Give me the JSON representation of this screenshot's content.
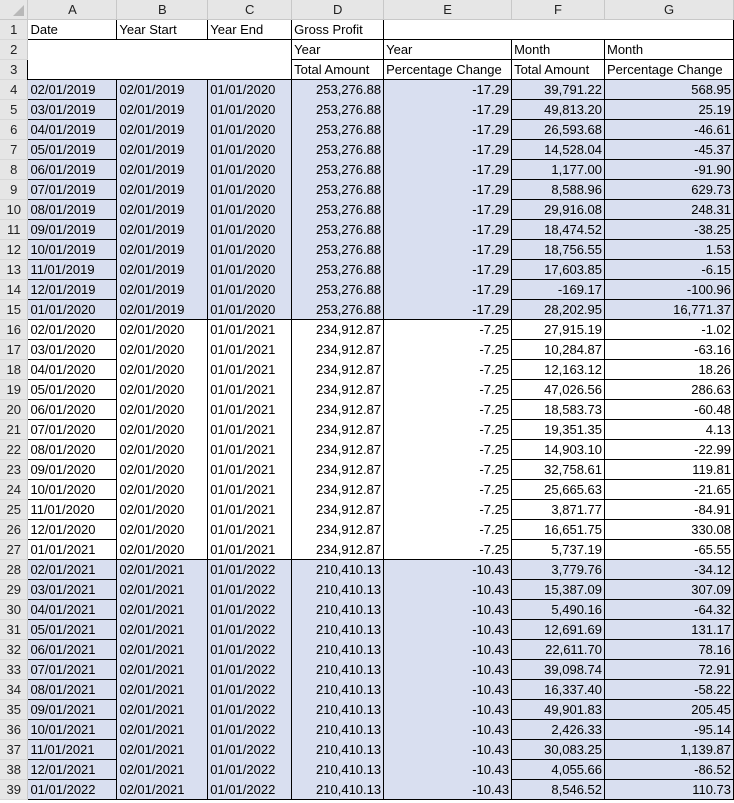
{
  "app": "Spreadsheet",
  "columns": [
    "A",
    "B",
    "C",
    "D",
    "E",
    "F",
    "G"
  ],
  "header": {
    "row1": {
      "A": "Date",
      "B": "Year Start",
      "C": "Year End",
      "D": "Gross Profit",
      "E": "",
      "F": "",
      "G": ""
    },
    "row2": {
      "D": "Year",
      "E": "Year",
      "F": "Month",
      "G": "Month"
    },
    "row3": {
      "D": "Total Amount",
      "E": "Percentage Change",
      "F": "Total Amount",
      "G": "Percentage Change"
    }
  },
  "band_color": "#d9dff0",
  "rows": [
    {
      "n": "4",
      "date": "02/01/2019",
      "ys": "02/01/2019",
      "ye": "01/01/2020",
      "ytot": "253,276.88",
      "ypct": "-17.29",
      "mtot": "39,791.22",
      "mpct": "568.95"
    },
    {
      "n": "5",
      "date": "03/01/2019",
      "ys": "02/01/2019",
      "ye": "01/01/2020",
      "ytot": "253,276.88",
      "ypct": "-17.29",
      "mtot": "49,813.20",
      "mpct": "25.19"
    },
    {
      "n": "6",
      "date": "04/01/2019",
      "ys": "02/01/2019",
      "ye": "01/01/2020",
      "ytot": "253,276.88",
      "ypct": "-17.29",
      "mtot": "26,593.68",
      "mpct": "-46.61"
    },
    {
      "n": "7",
      "date": "05/01/2019",
      "ys": "02/01/2019",
      "ye": "01/01/2020",
      "ytot": "253,276.88",
      "ypct": "-17.29",
      "mtot": "14,528.04",
      "mpct": "-45.37"
    },
    {
      "n": "8",
      "date": "06/01/2019",
      "ys": "02/01/2019",
      "ye": "01/01/2020",
      "ytot": "253,276.88",
      "ypct": "-17.29",
      "mtot": "1,177.00",
      "mpct": "-91.90"
    },
    {
      "n": "9",
      "date": "07/01/2019",
      "ys": "02/01/2019",
      "ye": "01/01/2020",
      "ytot": "253,276.88",
      "ypct": "-17.29",
      "mtot": "8,588.96",
      "mpct": "629.73"
    },
    {
      "n": "10",
      "date": "08/01/2019",
      "ys": "02/01/2019",
      "ye": "01/01/2020",
      "ytot": "253,276.88",
      "ypct": "-17.29",
      "mtot": "29,916.08",
      "mpct": "248.31"
    },
    {
      "n": "11",
      "date": "09/01/2019",
      "ys": "02/01/2019",
      "ye": "01/01/2020",
      "ytot": "253,276.88",
      "ypct": "-17.29",
      "mtot": "18,474.52",
      "mpct": "-38.25"
    },
    {
      "n": "12",
      "date": "10/01/2019",
      "ys": "02/01/2019",
      "ye": "01/01/2020",
      "ytot": "253,276.88",
      "ypct": "-17.29",
      "mtot": "18,756.55",
      "mpct": "1.53"
    },
    {
      "n": "13",
      "date": "11/01/2019",
      "ys": "02/01/2019",
      "ye": "01/01/2020",
      "ytot": "253,276.88",
      "ypct": "-17.29",
      "mtot": "17,603.85",
      "mpct": "-6.15"
    },
    {
      "n": "14",
      "date": "12/01/2019",
      "ys": "02/01/2019",
      "ye": "01/01/2020",
      "ytot": "253,276.88",
      "ypct": "-17.29",
      "mtot": "-169.17",
      "mpct": "-100.96"
    },
    {
      "n": "15",
      "date": "01/01/2020",
      "ys": "02/01/2019",
      "ye": "01/01/2020",
      "ytot": "253,276.88",
      "ypct": "-17.29",
      "mtot": "28,202.95",
      "mpct": "16,771.37"
    },
    {
      "n": "16",
      "date": "02/01/2020",
      "ys": "02/01/2020",
      "ye": "01/01/2021",
      "ytot": "234,912.87",
      "ypct": "-7.25",
      "mtot": "27,915.19",
      "mpct": "-1.02"
    },
    {
      "n": "17",
      "date": "03/01/2020",
      "ys": "02/01/2020",
      "ye": "01/01/2021",
      "ytot": "234,912.87",
      "ypct": "-7.25",
      "mtot": "10,284.87",
      "mpct": "-63.16"
    },
    {
      "n": "18",
      "date": "04/01/2020",
      "ys": "02/01/2020",
      "ye": "01/01/2021",
      "ytot": "234,912.87",
      "ypct": "-7.25",
      "mtot": "12,163.12",
      "mpct": "18.26"
    },
    {
      "n": "19",
      "date": "05/01/2020",
      "ys": "02/01/2020",
      "ye": "01/01/2021",
      "ytot": "234,912.87",
      "ypct": "-7.25",
      "mtot": "47,026.56",
      "mpct": "286.63"
    },
    {
      "n": "20",
      "date": "06/01/2020",
      "ys": "02/01/2020",
      "ye": "01/01/2021",
      "ytot": "234,912.87",
      "ypct": "-7.25",
      "mtot": "18,583.73",
      "mpct": "-60.48"
    },
    {
      "n": "21",
      "date": "07/01/2020",
      "ys": "02/01/2020",
      "ye": "01/01/2021",
      "ytot": "234,912.87",
      "ypct": "-7.25",
      "mtot": "19,351.35",
      "mpct": "4.13"
    },
    {
      "n": "22",
      "date": "08/01/2020",
      "ys": "02/01/2020",
      "ye": "01/01/2021",
      "ytot": "234,912.87",
      "ypct": "-7.25",
      "mtot": "14,903.10",
      "mpct": "-22.99"
    },
    {
      "n": "23",
      "date": "09/01/2020",
      "ys": "02/01/2020",
      "ye": "01/01/2021",
      "ytot": "234,912.87",
      "ypct": "-7.25",
      "mtot": "32,758.61",
      "mpct": "119.81"
    },
    {
      "n": "24",
      "date": "10/01/2020",
      "ys": "02/01/2020",
      "ye": "01/01/2021",
      "ytot": "234,912.87",
      "ypct": "-7.25",
      "mtot": "25,665.63",
      "mpct": "-21.65"
    },
    {
      "n": "25",
      "date": "11/01/2020",
      "ys": "02/01/2020",
      "ye": "01/01/2021",
      "ytot": "234,912.87",
      "ypct": "-7.25",
      "mtot": "3,871.77",
      "mpct": "-84.91"
    },
    {
      "n": "26",
      "date": "12/01/2020",
      "ys": "02/01/2020",
      "ye": "01/01/2021",
      "ytot": "234,912.87",
      "ypct": "-7.25",
      "mtot": "16,651.75",
      "mpct": "330.08"
    },
    {
      "n": "27",
      "date": "01/01/2021",
      "ys": "02/01/2020",
      "ye": "01/01/2021",
      "ytot": "234,912.87",
      "ypct": "-7.25",
      "mtot": "5,737.19",
      "mpct": "-65.55"
    },
    {
      "n": "28",
      "date": "02/01/2021",
      "ys": "02/01/2021",
      "ye": "01/01/2022",
      "ytot": "210,410.13",
      "ypct": "-10.43",
      "mtot": "3,779.76",
      "mpct": "-34.12"
    },
    {
      "n": "29",
      "date": "03/01/2021",
      "ys": "02/01/2021",
      "ye": "01/01/2022",
      "ytot": "210,410.13",
      "ypct": "-10.43",
      "mtot": "15,387.09",
      "mpct": "307.09"
    },
    {
      "n": "30",
      "date": "04/01/2021",
      "ys": "02/01/2021",
      "ye": "01/01/2022",
      "ytot": "210,410.13",
      "ypct": "-10.43",
      "mtot": "5,490.16",
      "mpct": "-64.32"
    },
    {
      "n": "31",
      "date": "05/01/2021",
      "ys": "02/01/2021",
      "ye": "01/01/2022",
      "ytot": "210,410.13",
      "ypct": "-10.43",
      "mtot": "12,691.69",
      "mpct": "131.17"
    },
    {
      "n": "32",
      "date": "06/01/2021",
      "ys": "02/01/2021",
      "ye": "01/01/2022",
      "ytot": "210,410.13",
      "ypct": "-10.43",
      "mtot": "22,611.70",
      "mpct": "78.16"
    },
    {
      "n": "33",
      "date": "07/01/2021",
      "ys": "02/01/2021",
      "ye": "01/01/2022",
      "ytot": "210,410.13",
      "ypct": "-10.43",
      "mtot": "39,098.74",
      "mpct": "72.91"
    },
    {
      "n": "34",
      "date": "08/01/2021",
      "ys": "02/01/2021",
      "ye": "01/01/2022",
      "ytot": "210,410.13",
      "ypct": "-10.43",
      "mtot": "16,337.40",
      "mpct": "-58.22"
    },
    {
      "n": "35",
      "date": "09/01/2021",
      "ys": "02/01/2021",
      "ye": "01/01/2022",
      "ytot": "210,410.13",
      "ypct": "-10.43",
      "mtot": "49,901.83",
      "mpct": "205.45"
    },
    {
      "n": "36",
      "date": "10/01/2021",
      "ys": "02/01/2021",
      "ye": "01/01/2022",
      "ytot": "210,410.13",
      "ypct": "-10.43",
      "mtot": "2,426.33",
      "mpct": "-95.14"
    },
    {
      "n": "37",
      "date": "11/01/2021",
      "ys": "02/01/2021",
      "ye": "01/01/2022",
      "ytot": "210,410.13",
      "ypct": "-10.43",
      "mtot": "30,083.25",
      "mpct": "1,139.87"
    },
    {
      "n": "38",
      "date": "12/01/2021",
      "ys": "02/01/2021",
      "ye": "01/01/2022",
      "ytot": "210,410.13",
      "ypct": "-10.43",
      "mtot": "4,055.66",
      "mpct": "-86.52"
    },
    {
      "n": "39",
      "date": "01/01/2022",
      "ys": "02/01/2021",
      "ye": "01/01/2022",
      "ytot": "210,410.13",
      "ypct": "-10.43",
      "mtot": "8,546.52",
      "mpct": "110.73"
    }
  ]
}
